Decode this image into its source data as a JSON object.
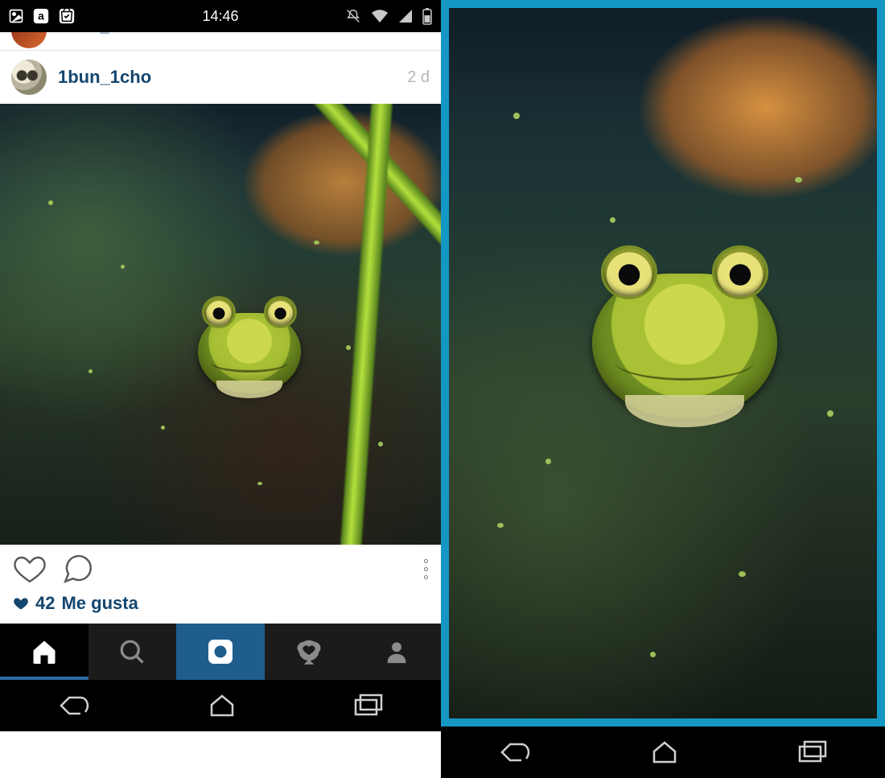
{
  "statusbar": {
    "time": "14:46"
  },
  "prev_post": {
    "username": "david_d"
  },
  "post": {
    "username": "1bun_1cho",
    "time": "2 d",
    "likes_count": "42",
    "likes_label": "Me gusta"
  }
}
